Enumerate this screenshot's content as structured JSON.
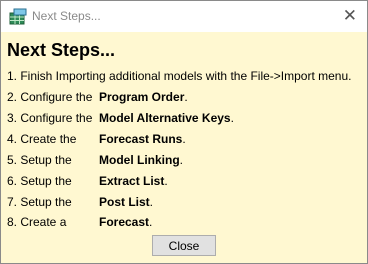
{
  "window": {
    "title": "Next Steps...",
    "close_glyph": "✕",
    "icon": "grid-table-app-icon"
  },
  "heading": "Next Steps...",
  "steps": [
    {
      "prefix": "1. Finish Importing additional models with the File->Import menu.",
      "target": "",
      "suffix": ""
    },
    {
      "prefix": "2. Configure the",
      "target": "Program Order",
      "suffix": "."
    },
    {
      "prefix": "3. Configure the",
      "target": "Model Alternative Keys",
      "suffix": "."
    },
    {
      "prefix": "4. Create the",
      "target": "Forecast Runs",
      "suffix": "."
    },
    {
      "prefix": "5. Setup the",
      "target": "Model Linking",
      "suffix": "."
    },
    {
      "prefix": "6. Setup the",
      "target": "Extract List",
      "suffix": "."
    },
    {
      "prefix": "7. Setup the",
      "target": "Post List",
      "suffix": "."
    },
    {
      "prefix": "8. Create a",
      "target": "Forecast",
      "suffix": "."
    }
  ],
  "buttons": {
    "close": "Close"
  },
  "colors": {
    "background": "#fff8d1",
    "button": "#e1e1e1",
    "title_text": "#8a8a8a"
  }
}
